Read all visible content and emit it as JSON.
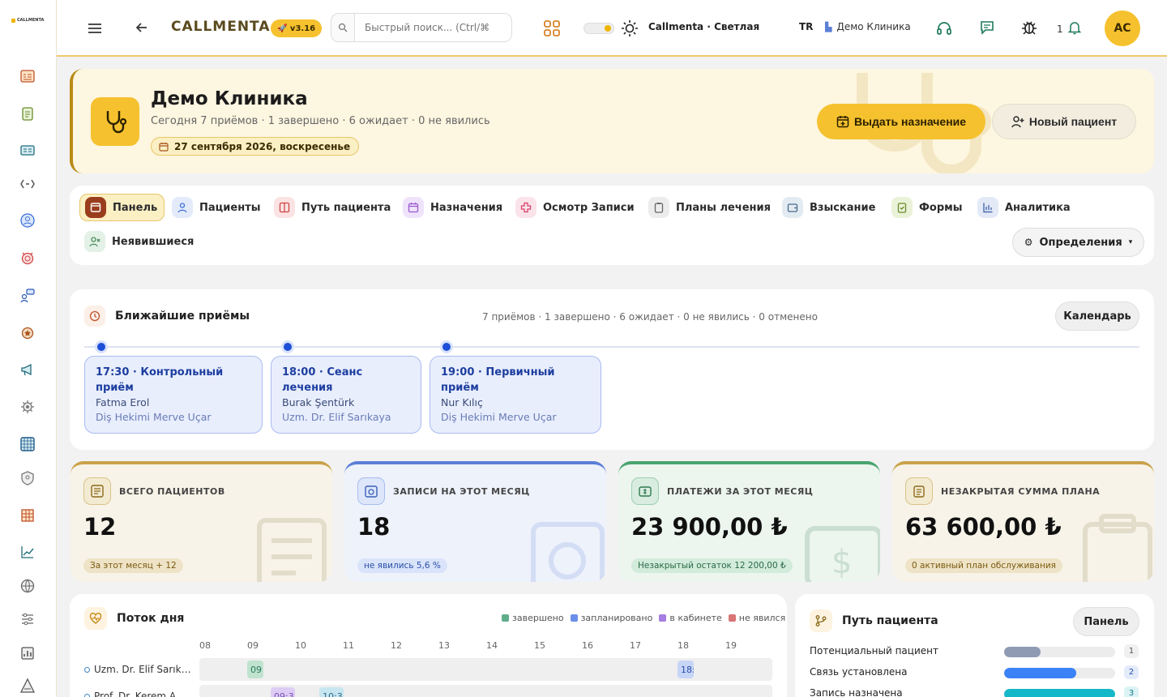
{
  "app": {
    "logo_text": "CALLMENTA",
    "brand": "CALLMENTA",
    "version": "🚀 v3.16"
  },
  "topbar": {
    "search_placeholder": "Быстрый поиск... (Ctrl/⌘",
    "theme_label": "Callmenta · Светлая",
    "language": "TR",
    "clinic": "Демо Клиника",
    "notification_count": "1",
    "user_initials": "AC"
  },
  "hero": {
    "title": "Демо Клиника",
    "subtitle": "Сегодня 7 приёмов · 1 завершено · 6 ожидает · 0 не явились",
    "date": "27 сентября 2026, воскресенье",
    "primary_button": "Выдать назначение",
    "secondary_button": "Новый пациент"
  },
  "tabs": [
    {
      "label": "Панель",
      "icon": "panel-icon",
      "color": "#9a3d1c"
    },
    {
      "label": "Пациенты",
      "icon": "user-icon",
      "color": "#3b6fd8"
    },
    {
      "label": "Путь пациента",
      "icon": "columns-icon",
      "color": "#d04545"
    },
    {
      "label": "Назначения",
      "icon": "calendar-icon",
      "color": "#9b59d0"
    },
    {
      "label": "Осмотр Записи",
      "icon": "plus-icon",
      "color": "#d8406a"
    },
    {
      "label": "Планы лечения",
      "icon": "clipboard-icon",
      "color": "#666666"
    },
    {
      "label": "Взыскание",
      "icon": "wallet-icon",
      "color": "#4a6a8a"
    },
    {
      "label": "Формы",
      "icon": "clipboard-check-icon",
      "color": "#6a8a2a"
    },
    {
      "label": "Аналитика",
      "icon": "bar-chart-icon",
      "color": "#4a6ab0"
    },
    {
      "label": "Неявившиеся",
      "icon": "user-x-icon",
      "color": "#4a8a5a"
    }
  ],
  "definitions_button": "Определения",
  "upcoming": {
    "title": "Ближайшие приёмы",
    "stats": "7 приёмов · 1 завершено · 6 ожидает · 0 не явились · 0 отменено",
    "calendar_button": "Календарь",
    "items": [
      {
        "time_title": "17:30 · Контрольный приём",
        "patient": "Fatma Erol",
        "doctor": "Diş Hekimi Merve Uçar"
      },
      {
        "time_title": "18:00 · Сеанс лечения",
        "patient": "Burak Şentürk",
        "doctor": "Uzm. Dr. Elif Sarıkaya"
      },
      {
        "time_title": "19:00 · Первичный приём",
        "patient": "Nur Kılıç",
        "doctor": "Diş Hekimi Merve Uçar"
      }
    ]
  },
  "kpis": [
    {
      "label": "ВСЕГО ПАЦИЕНТОВ",
      "value": "12",
      "pill": "За этот месяц + 12",
      "accent": "#c9a24a"
    },
    {
      "label": "ЗАПИСИ НА ЭТОТ МЕСЯЦ",
      "value": "18",
      "pill": "не явились 5,6 %",
      "accent": "#5b7fd6"
    },
    {
      "label": "ПЛАТЕЖИ ЗА ЭТОТ МЕСЯЦ",
      "value": "23 900,00 ₺",
      "pill": "Незакрытый остаток 12 200,00 ₺",
      "accent": "#4aa36f"
    },
    {
      "label": "НЕЗАКРЫТАЯ СУММА ПЛАНА",
      "value": "63 600,00 ₺",
      "pill": "0 активный план обслуживания",
      "accent": "#c9a24a"
    }
  ],
  "flow": {
    "title": "Поток дня",
    "legend": [
      {
        "label": "завершено",
        "color": "#5fae8a"
      },
      {
        "label": "запланировано",
        "color": "#6b8ee8"
      },
      {
        "label": "в кабинете",
        "color": "#a67de0"
      },
      {
        "label": "не явился",
        "color": "#d87575"
      }
    ],
    "hours": [
      "08",
      "09",
      "10",
      "11",
      "12",
      "13",
      "14",
      "15",
      "16",
      "17",
      "18",
      "19"
    ],
    "rows": [
      {
        "name": "Uzm. Dr. Elif Sarık…",
        "bars": [
          {
            "label": "09",
            "status": "завершено"
          },
          {
            "label": "18:",
            "status": "запланировано"
          }
        ]
      },
      {
        "name": "Prof. Dr. Kerem A…",
        "bars": [
          {
            "label": "09:3",
            "status": "в кабинете"
          },
          {
            "label": "10:3",
            "status": "запланировано"
          }
        ]
      }
    ]
  },
  "journey": {
    "title": "Путь пациента",
    "panel_button": "Панель",
    "stages": [
      {
        "label": "Потенциальный пациент",
        "count": "1",
        "fill": 0.33,
        "color": "#8e9bb3"
      },
      {
        "label": "Связь установлена",
        "count": "2",
        "fill": 0.65,
        "color": "#3b82f6"
      },
      {
        "label": "Запись назначена",
        "count": "3",
        "fill": 1.0,
        "color": "#14b8c8"
      }
    ]
  },
  "sidebar_icons": [
    "calendar-grid-icon",
    "clipboard-icon",
    "id-card-icon",
    "code-icon",
    "user-circle-icon",
    "alarm-icon",
    "chat-user-icon",
    "medal-icon",
    "megaphone-icon",
    "gear-icon",
    "grid-icon",
    "shield-icon",
    "building-icon",
    "chart-icon",
    "globe-icon",
    "sliders-icon",
    "report-icon",
    "triangle-icon"
  ]
}
